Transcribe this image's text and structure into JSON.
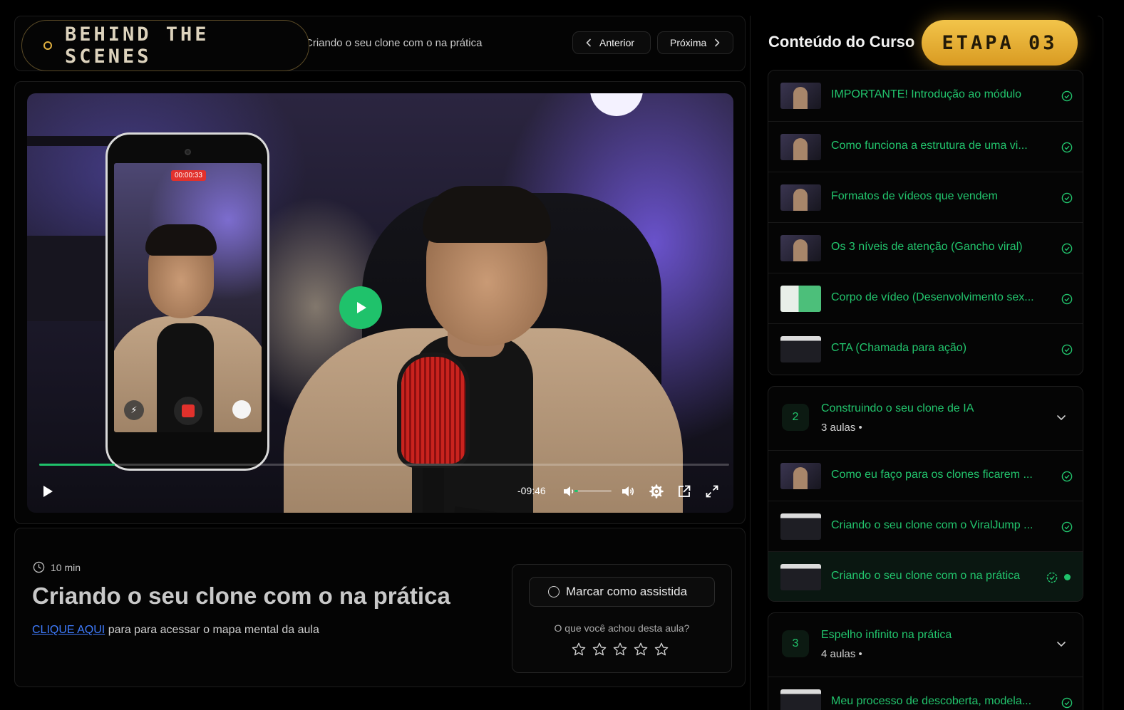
{
  "header": {
    "brand": "BEHIND THE SCENES",
    "breadcrumb": "Criando o seu clone com o na prática",
    "prev_label": "Anterior",
    "next_label": "Próxima"
  },
  "player": {
    "recording_time": "00:00:33",
    "time_remaining": "-09:46",
    "progress_fraction": 0.11,
    "volume_fraction": 0.1,
    "accent_color": "#1fc26b"
  },
  "lesson": {
    "duration": "10 min",
    "title": "Criando o seu clone com o na prática",
    "link_text": "CLIQUE AQUI",
    "link_suffix": " para para acessar o mapa mental da aula",
    "mark_label": "Marcar como assistida",
    "rating_question": "O que você achou desta aula?",
    "rating_max": 5
  },
  "sidebar": {
    "title": "Conteúdo do Curso",
    "stage_badge": "ETAPA 03",
    "module1_lessons": [
      {
        "label": "IMPORTANTE! Introdução ao módulo",
        "status": "completed"
      },
      {
        "label": "Como funciona a estrutura de uma vi...",
        "status": "completed"
      },
      {
        "label": "Formatos de vídeos que vendem",
        "status": "completed"
      },
      {
        "label": "Os 3 níveis de atenção (Gancho viral)",
        "status": "completed"
      },
      {
        "label": "Corpo de vídeo (Desenvolvimento sex...",
        "status": "completed"
      },
      {
        "label": "CTA (Chamada para ação)",
        "status": "completed"
      }
    ],
    "module2": {
      "number": "2",
      "title": "Construindo o seu clone de IA",
      "count": "3 aulas •",
      "lessons": [
        {
          "label": "Como eu faço para os clones ficarem ...",
          "status": "completed"
        },
        {
          "label": "Criando o seu clone com o ViralJump ...",
          "status": "completed"
        },
        {
          "label": "Criando o seu clone com o na prática",
          "status": "current"
        }
      ]
    },
    "module3": {
      "number": "3",
      "title": "Espelho infinito na prática",
      "count": "4 aulas •",
      "lessons": [
        {
          "label": "Meu processo de descoberta, modela...",
          "status": "completed"
        }
      ]
    }
  }
}
